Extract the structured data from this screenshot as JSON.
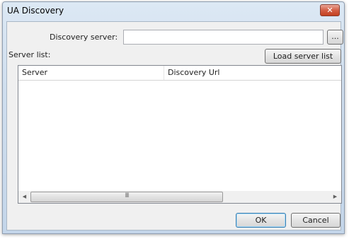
{
  "window": {
    "title": "UA Discovery",
    "close_glyph": "✕"
  },
  "form": {
    "discovery_server_label": "Discovery server:",
    "discovery_server_value": "",
    "browse_label": "...",
    "server_list_label": "Server list:",
    "load_button_label": "Load server list"
  },
  "list": {
    "columns": [
      "Server",
      "Discovery Url"
    ],
    "rows": []
  },
  "scrollbar": {
    "left_arrow": "◀",
    "right_arrow": "▶",
    "grip": "III"
  },
  "buttons": {
    "ok": "OK",
    "cancel": "Cancel"
  },
  "colors": {
    "close_button": "#d45f45",
    "window_frame": "#cfdeee",
    "client_bg": "#f0f0f0"
  }
}
